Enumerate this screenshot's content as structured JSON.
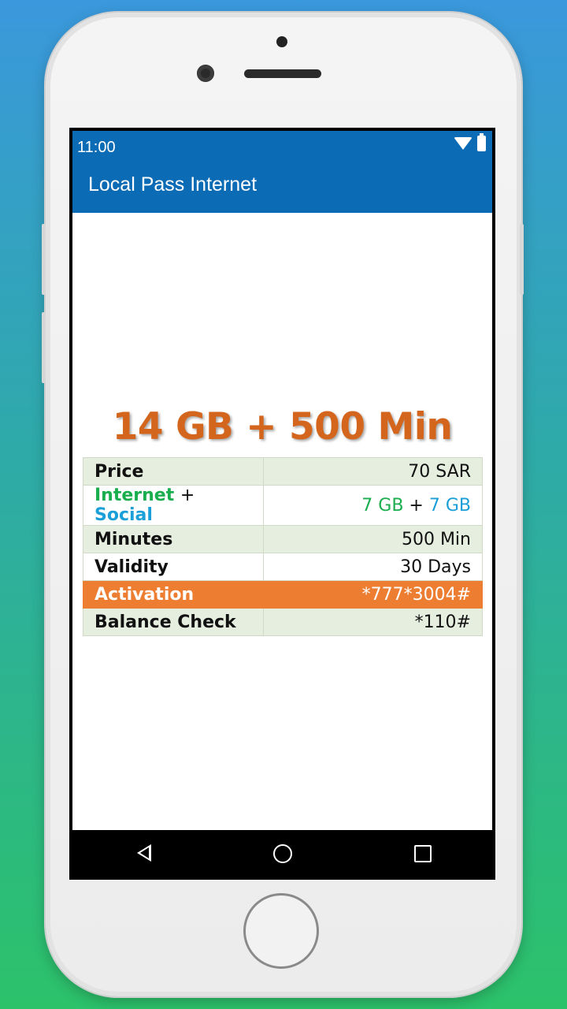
{
  "status": {
    "time": "11:00"
  },
  "app": {
    "title": "Local Pass Internet"
  },
  "offer": {
    "headline": "14 GB + 500 Min",
    "rows": {
      "price": {
        "label": "Price",
        "value": "70 SAR"
      },
      "data": {
        "label_internet": "Internet",
        "label_plus": "+",
        "label_social": "Social",
        "value_internet": "7 GB",
        "value_plus": "+",
        "value_social": "7 GB"
      },
      "minutes": {
        "label": "Minutes",
        "value": "500 Min"
      },
      "validity": {
        "label": "Validity",
        "value": "30 Days"
      },
      "activation": {
        "label": "Activation",
        "value": "*777*3004#"
      },
      "balance": {
        "label": "Balance Check",
        "value": "*110#"
      }
    }
  },
  "nav": {
    "back_icon": "back-triangle",
    "home_icon": "home-circle",
    "recents_icon": "recents-square"
  },
  "colors": {
    "appbar": "#0b6bb5",
    "headline": "#d4651c",
    "activation_row": "#ed7d31",
    "price": "#e8262b",
    "internet": "#1aae4e",
    "social": "#1a9fd8"
  }
}
